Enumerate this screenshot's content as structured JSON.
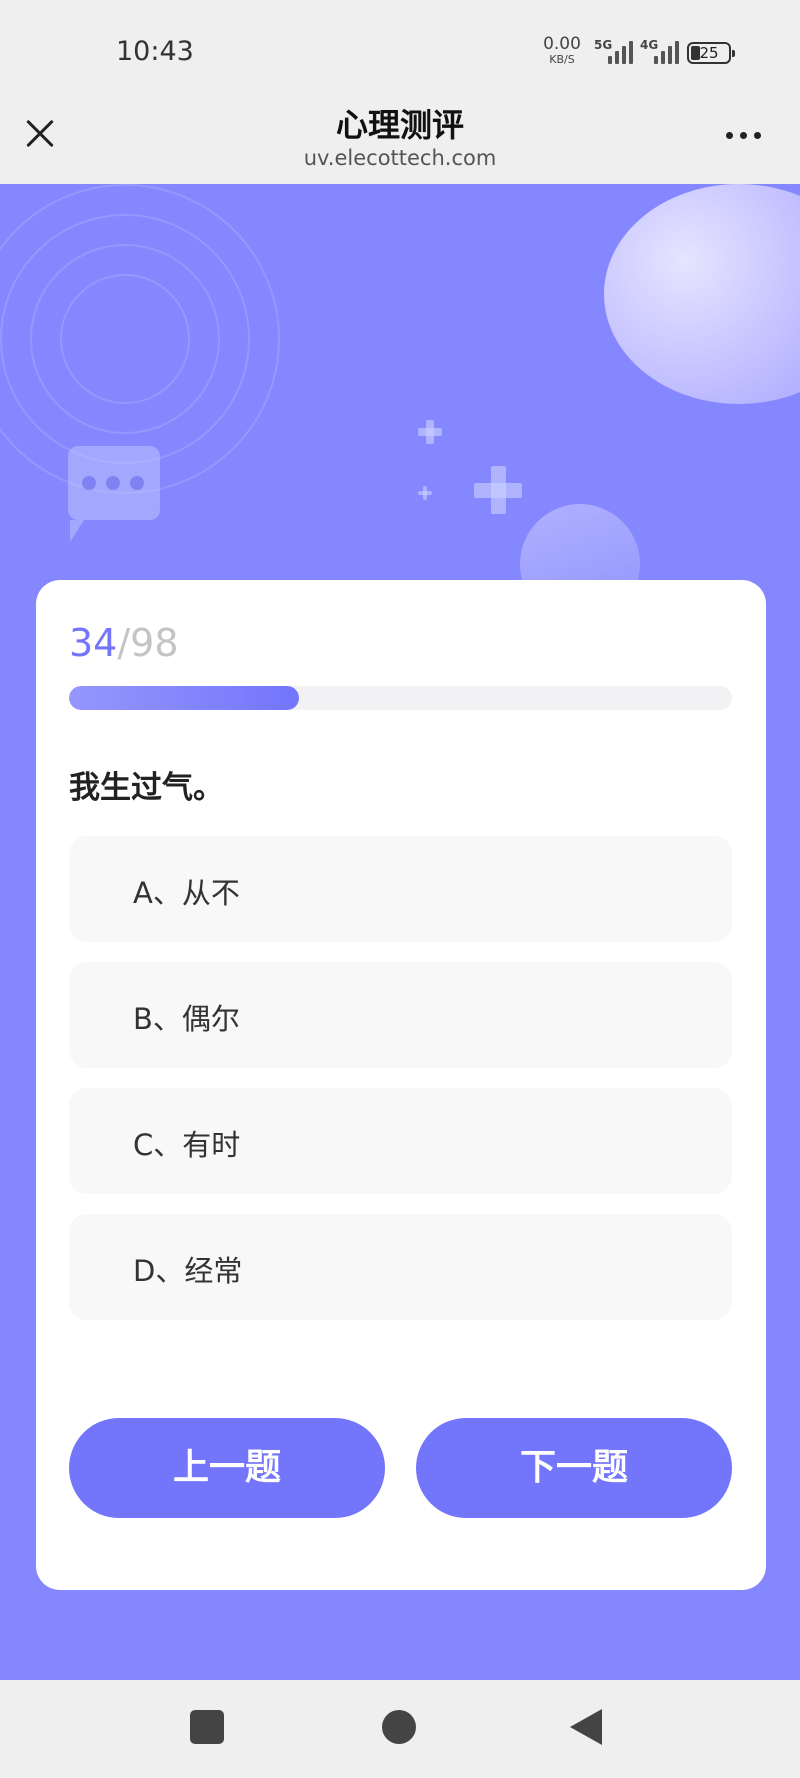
{
  "status_bar": {
    "time": "10:43",
    "net_speed_value": "0.00",
    "net_speed_unit": "KB/S",
    "signal_1_label": "5G",
    "signal_2_label": "4G",
    "battery_level": "25"
  },
  "nav": {
    "title": "心理测评",
    "url": "uv.elecottech.com",
    "close_icon": "close-icon",
    "more_icon": "more-icon"
  },
  "quiz": {
    "current": "34",
    "separator": "/",
    "total": "98",
    "progress_fraction": 0.347,
    "question": "我生过气。",
    "options": [
      {
        "label": "A、从不"
      },
      {
        "label": "B、偶尔"
      },
      {
        "label": "C、有时"
      },
      {
        "label": "D、经常"
      }
    ],
    "prev_label": "上一题",
    "next_label": "下一题"
  },
  "colors": {
    "accent": "#7375fb",
    "background": "#8487fd",
    "option_bg": "#f8f8f8"
  }
}
